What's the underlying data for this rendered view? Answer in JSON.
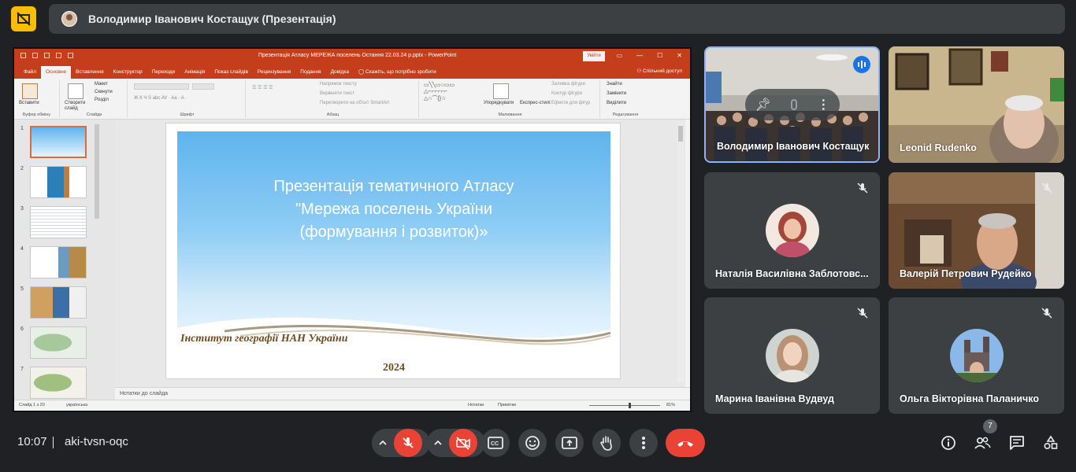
{
  "meeting": {
    "presenter_title": "Володимир Іванович Костащук (Презентація)",
    "time": "10:07",
    "code": "aki-tvsn-oqc",
    "participants_count": "7"
  },
  "ppt": {
    "doc_title": "Презентація Атласу МЕРЕЖА поселень Остання 22.03.24 р.pptx  -  PowerPoint",
    "login_label": "Увійти",
    "tabs": [
      "Файл",
      "Основне",
      "Вставлення",
      "Конструктор",
      "Переходи",
      "Анімація",
      "Показ слайдів",
      "Рецензування",
      "Подання",
      "Довідка"
    ],
    "tell_me": "Скажіть, що потрібно зробити",
    "share": "Спільний доступ",
    "ribbon": {
      "paste": "Вставити",
      "new_slide": "Створити слайд",
      "layout": "Макет",
      "reset": "Скинути",
      "section": "Розділ",
      "text_direction": "Напрямок тексту",
      "align_text": "Вирівняти текст",
      "smartart": "Перетворити на об'єкт SmartArt",
      "arrange": "Упорядкувати",
      "quick_styles": "Експрес-стилі",
      "shape_fill": "Заливка фігури",
      "shape_outline": "Контур фігури",
      "shape_effects": "Ефекти для фігур",
      "find": "Знайти",
      "replace": "Замінити",
      "select": "Виділити",
      "group_clipboard": "Буфер обміну",
      "group_slides": "Слайди",
      "group_font": "Шрифт",
      "group_paragraph": "Абзац",
      "group_drawing": "Малювання",
      "group_editing": "Редагування"
    },
    "thumb_numbers": [
      "1",
      "2",
      "3",
      "4",
      "5",
      "6",
      "7"
    ],
    "slide": {
      "title_line1": "Презентація тематичного Атласу",
      "title_line2": "\"Мережа поселень України",
      "title_line3": "(формування і розвиток)»",
      "institute": "Інститут географії НАН України",
      "year": "2024"
    },
    "notes_placeholder": "Нотатки до слайда",
    "status": {
      "slide_info": "Слайд 1 з 20",
      "language": "українська",
      "notes": "Нотатки",
      "comments": "Примітки",
      "zoom": "81%"
    }
  },
  "tiles": [
    {
      "name": "Володимир Іванович Костащук",
      "state": "speaking"
    },
    {
      "name": "Leonid Rudenko",
      "state": "camera"
    },
    {
      "name": "Наталія Василівна Заблотовс...",
      "state": "muted"
    },
    {
      "name": "Валерій Петрович Рудейко",
      "state": "muted"
    },
    {
      "name": "Марина Іванівна Вудвуд",
      "state": "muted"
    },
    {
      "name": "Ольга Вікторівна Паланичко",
      "state": "muted"
    }
  ],
  "icons": {
    "present_indicator": "presentation-off-icon",
    "mic": "mic-off-icon",
    "camera": "camera-off-icon",
    "captions": "captions-icon",
    "emoji": "emoji-icon",
    "present": "present-screen-icon",
    "hand": "raise-hand-icon",
    "more": "more-vert-icon",
    "hangup": "call-end-icon",
    "info": "info-icon",
    "people": "people-icon",
    "chat": "chat-icon",
    "activities": "activities-icon"
  },
  "colors": {
    "accent_yellow": "#fbbc04",
    "ppt_red": "#c43e1c",
    "danger_red": "#ea4335",
    "speaking_blue": "#8ab4f8"
  }
}
